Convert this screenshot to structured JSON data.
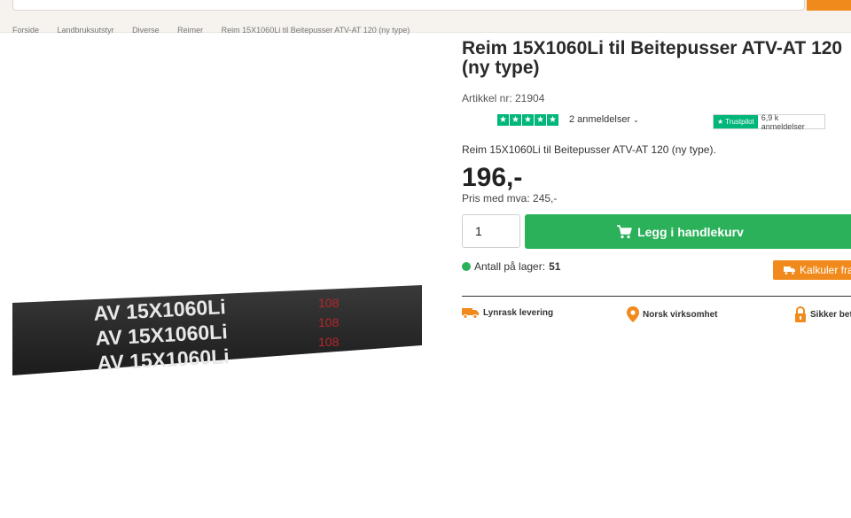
{
  "header": {
    "search": {
      "placeholder": ""
    }
  },
  "breadcrumb": {
    "items": [
      "Forside",
      "Landbruksutstyr",
      "Diverse",
      "Reimer",
      "Reim 15X1060Li til Beitepusser ATV-AT 120 (ny type)"
    ]
  },
  "product": {
    "title": "Reim 15X1060Li til Beitepusser ATV-AT 120 (ny type)",
    "article": "Artikkel nr: 21904",
    "rating_stars": 5,
    "reviews_label": "2 anmeldelser",
    "description": "Reim 15X1060Li til Beitepusser ATV-AT 120 (ny type).",
    "price": "196,-",
    "price_vat": "Pris med mva: 245,-",
    "quantity": "1",
    "add_to_cart_label": "Legg i handlekurv",
    "stock_label": "Antall på lager:",
    "stock_count": "51",
    "freight_label": "Kalkuler frakt",
    "image": {
      "belt_text": "AV 15X1060Li",
      "belt_code": "108"
    }
  },
  "trustpilot": {
    "brand": "Trustpilot",
    "count": "6,9 k anmeldelser"
  },
  "usps": [
    {
      "icon": "truck-icon",
      "label": "Lynrask levering"
    },
    {
      "icon": "location-pin-icon",
      "label": "Norsk virksomhet"
    },
    {
      "icon": "lock-icon",
      "label": "Sikker betaling"
    }
  ],
  "colors": {
    "accent_orange": "#f18a1c",
    "green": "#2bb15a",
    "trustpilot_green": "#00b67a"
  }
}
